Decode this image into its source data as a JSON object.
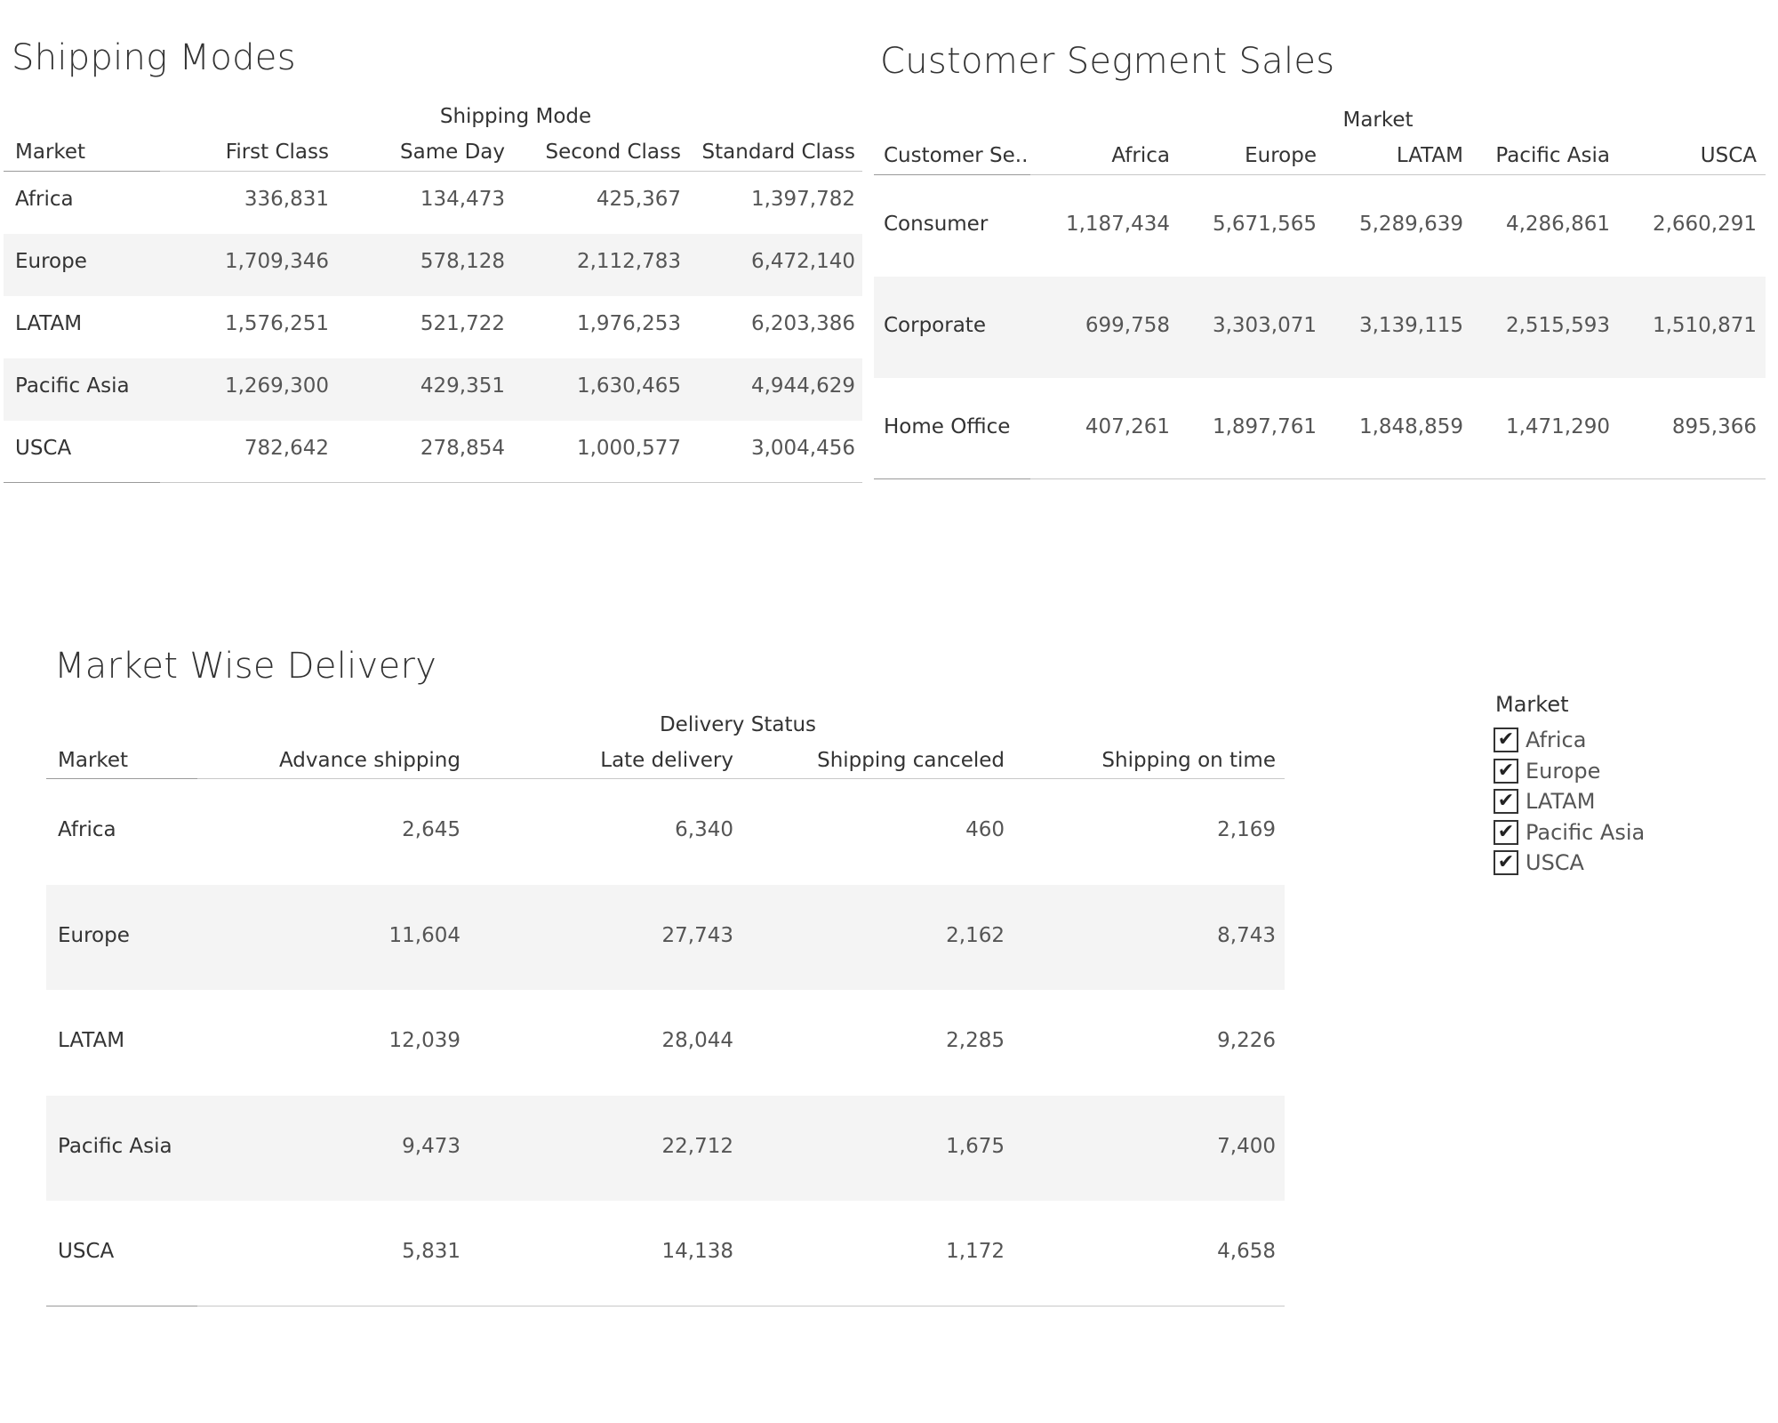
{
  "shipping_modes": {
    "title": "Shipping Modes",
    "group_header": "Shipping Mode",
    "row_header": "Market",
    "columns": [
      "First Class",
      "Same Day",
      "Second Class",
      "Standard Class"
    ],
    "rows": [
      {
        "label": "Africa",
        "values": [
          "336,831",
          "134,473",
          "425,367",
          "1,397,782"
        ]
      },
      {
        "label": "Europe",
        "values": [
          "1,709,346",
          "578,128",
          "2,112,783",
          "6,472,140"
        ]
      },
      {
        "label": "LATAM",
        "values": [
          "1,576,251",
          "521,722",
          "1,976,253",
          "6,203,386"
        ]
      },
      {
        "label": "Pacific Asia",
        "values": [
          "1,269,300",
          "429,351",
          "1,630,465",
          "4,944,629"
        ]
      },
      {
        "label": "USCA",
        "values": [
          "782,642",
          "278,854",
          "1,000,577",
          "3,004,456"
        ]
      }
    ]
  },
  "customer_segment_sales": {
    "title": "Customer Segment Sales",
    "group_header": "Market",
    "row_header": "Customer Se..",
    "columns": [
      "Africa",
      "Europe",
      "LATAM",
      "Pacific Asia",
      "USCA"
    ],
    "rows": [
      {
        "label": "Consumer",
        "values": [
          "1,187,434",
          "5,671,565",
          "5,289,639",
          "4,286,861",
          "2,660,291"
        ]
      },
      {
        "label": "Corporate",
        "values": [
          "699,758",
          "3,303,071",
          "3,139,115",
          "2,515,593",
          "1,510,871"
        ]
      },
      {
        "label": "Home Office",
        "values": [
          "407,261",
          "1,897,761",
          "1,848,859",
          "1,471,290",
          "895,366"
        ]
      }
    ]
  },
  "market_wise_delivery": {
    "title": "Market Wise Delivery",
    "group_header": "Delivery Status",
    "row_header": "Market",
    "columns": [
      "Advance shipping",
      "Late delivery",
      "Shipping canceled",
      "Shipping on time"
    ],
    "rows": [
      {
        "label": "Africa",
        "values": [
          "2,645",
          "6,340",
          "460",
          "2,169"
        ]
      },
      {
        "label": "Europe",
        "values": [
          "11,604",
          "27,743",
          "2,162",
          "8,743"
        ]
      },
      {
        "label": "LATAM",
        "values": [
          "12,039",
          "28,044",
          "2,285",
          "9,226"
        ]
      },
      {
        "label": "Pacific Asia",
        "values": [
          "9,473",
          "22,712",
          "1,675",
          "7,400"
        ]
      },
      {
        "label": "USCA",
        "values": [
          "5,831",
          "14,138",
          "1,172",
          "4,658"
        ]
      }
    ]
  },
  "market_filter": {
    "title": "Market",
    "items": [
      {
        "label": "Africa",
        "checked": true
      },
      {
        "label": "Europe",
        "checked": true
      },
      {
        "label": "LATAM",
        "checked": true
      },
      {
        "label": "Pacific Asia",
        "checked": true
      },
      {
        "label": "USCA",
        "checked": true
      }
    ],
    "check_glyph": "✔"
  }
}
